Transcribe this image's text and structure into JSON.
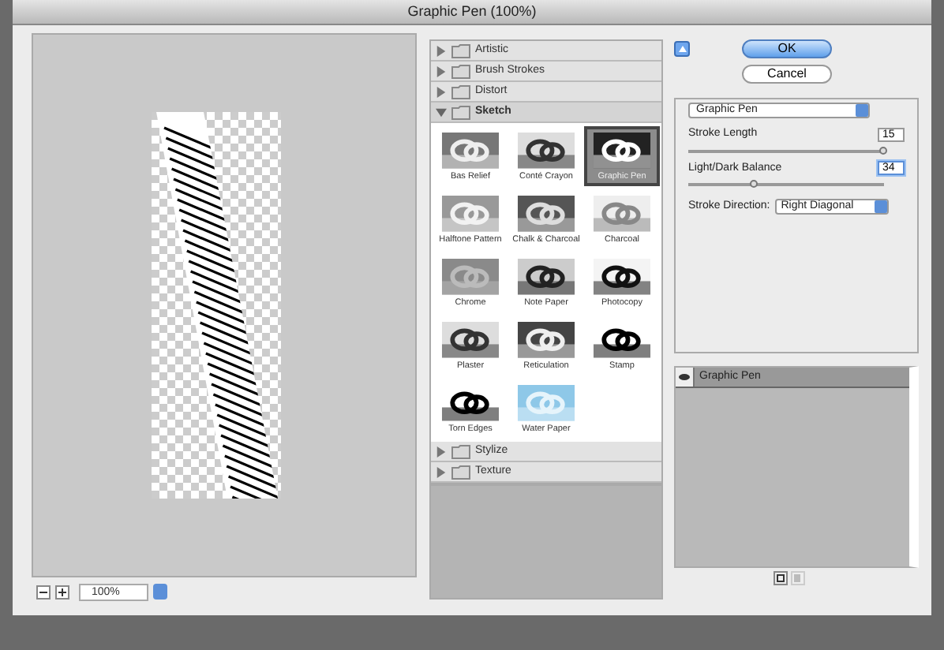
{
  "window": {
    "title": "Graphic Pen (100%)"
  },
  "preview": {
    "zoom": "100%"
  },
  "categories": [
    {
      "name": "Artistic",
      "expanded": false
    },
    {
      "name": "Brush Strokes",
      "expanded": false
    },
    {
      "name": "Distort",
      "expanded": false
    },
    {
      "name": "Sketch",
      "expanded": true,
      "filters": [
        {
          "name": "Bas Relief",
          "selected": false
        },
        {
          "name": "Conté Crayon",
          "selected": false
        },
        {
          "name": "Graphic Pen",
          "selected": true
        },
        {
          "name": "Halftone Pattern",
          "selected": false
        },
        {
          "name": "Chalk & Charcoal",
          "selected": false
        },
        {
          "name": "Charcoal",
          "selected": false
        },
        {
          "name": "Chrome",
          "selected": false
        },
        {
          "name": "Note Paper",
          "selected": false
        },
        {
          "name": "Photocopy",
          "selected": false
        },
        {
          "name": "Plaster",
          "selected": false
        },
        {
          "name": "Reticulation",
          "selected": false
        },
        {
          "name": "Stamp",
          "selected": false
        },
        {
          "name": "Torn Edges",
          "selected": false
        },
        {
          "name": "Water Paper",
          "selected": false
        }
      ]
    },
    {
      "name": "Stylize",
      "expanded": false
    },
    {
      "name": "Texture",
      "expanded": false
    }
  ],
  "buttons": {
    "ok": "OK",
    "cancel": "Cancel"
  },
  "settings": {
    "filter": "Graphic Pen",
    "sliders": [
      {
        "label": "Stroke Length",
        "value": "15",
        "level": 1.0,
        "focused": false
      },
      {
        "label": "Light/Dark Balance",
        "value": "34",
        "level": 0.34,
        "focused": true
      }
    ],
    "stroke_direction": {
      "label": "Stroke Direction:",
      "value": "Right Diagonal"
    }
  },
  "effect_layers": [
    {
      "name": "Graphic Pen",
      "selected": true
    }
  ]
}
